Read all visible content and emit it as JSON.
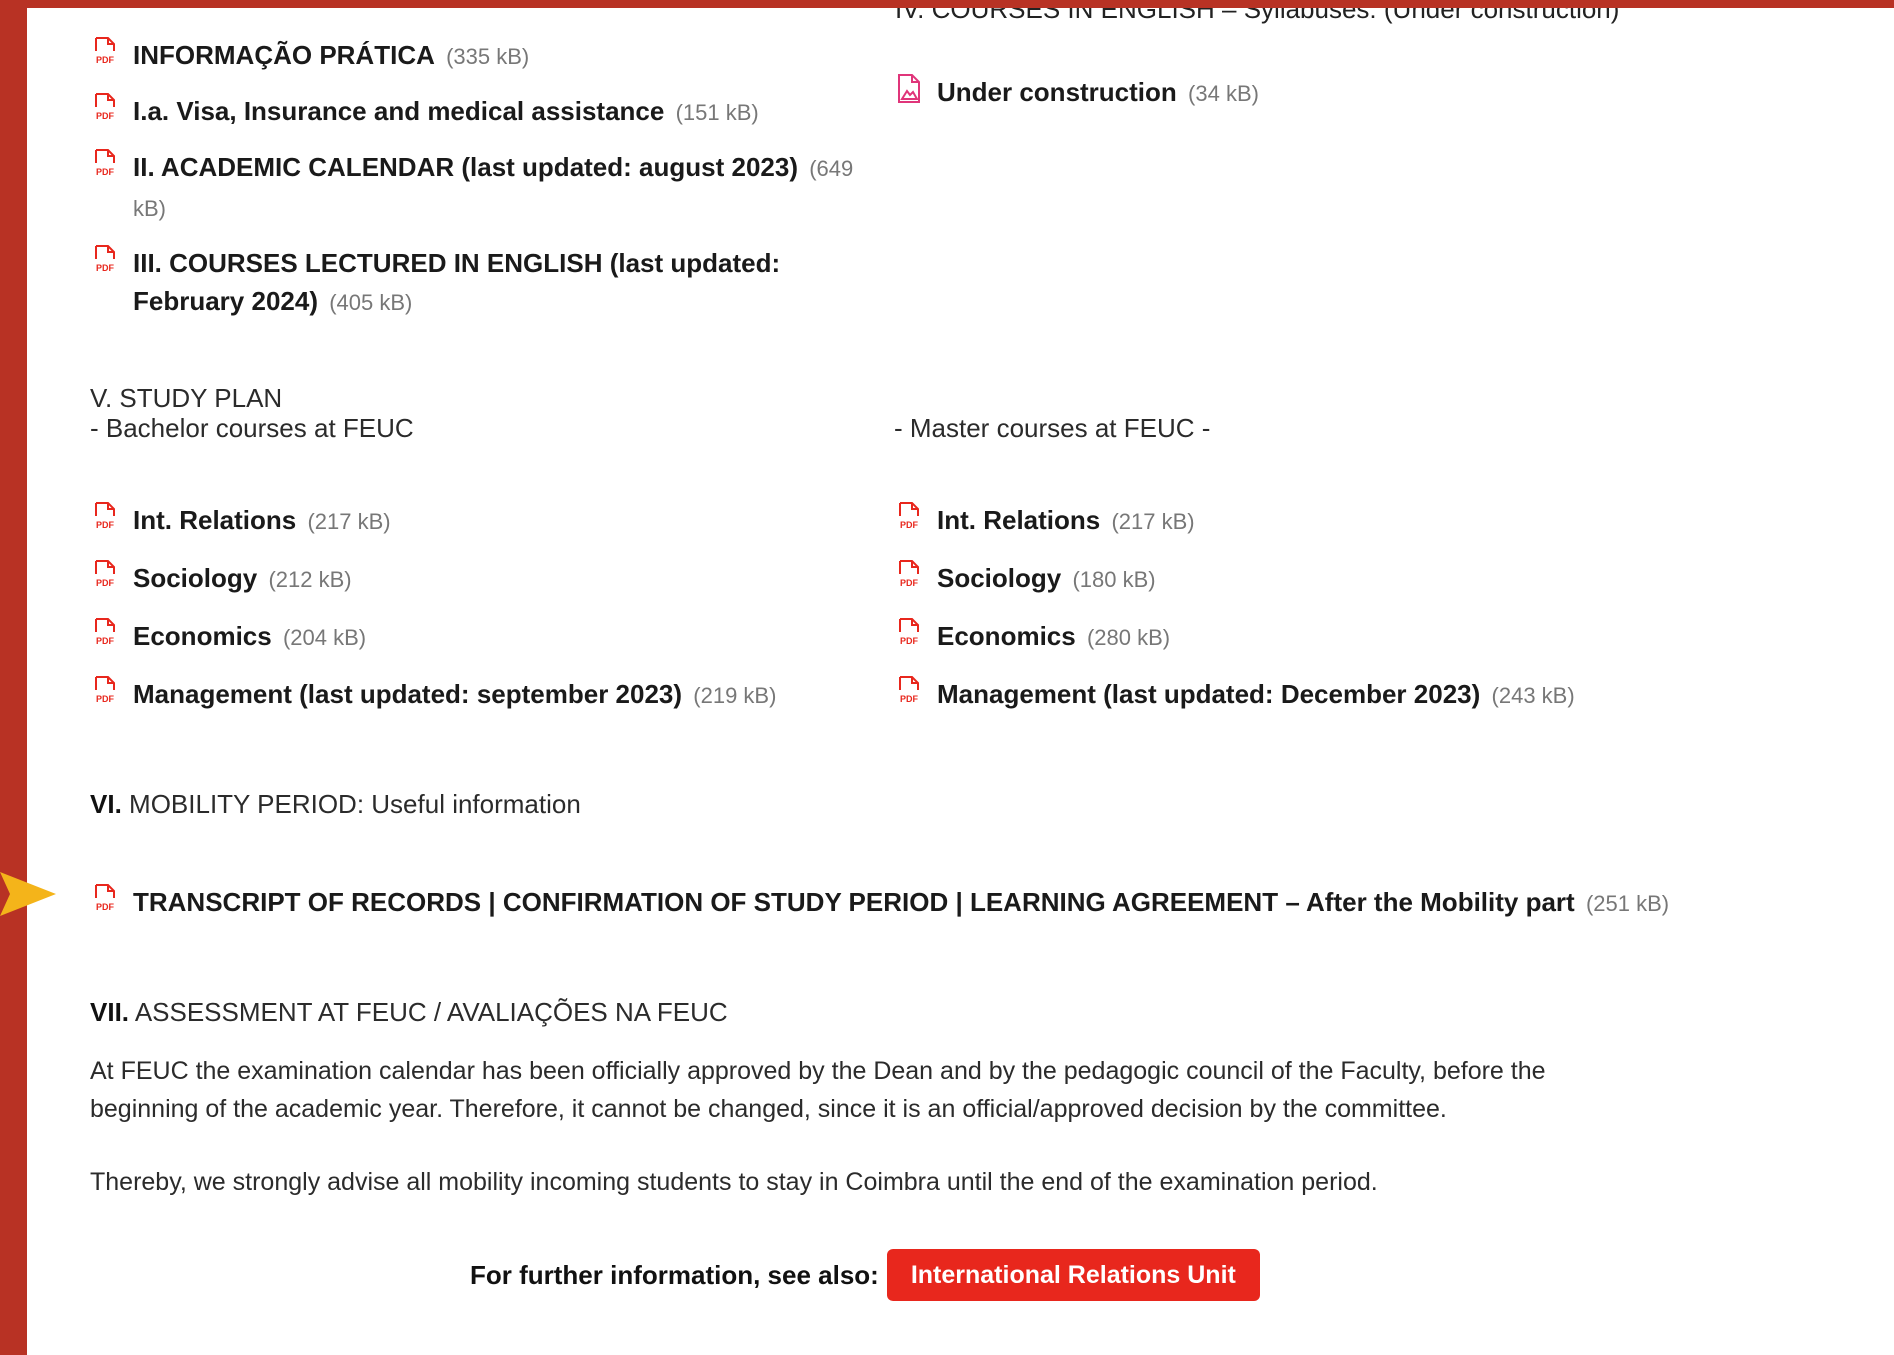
{
  "top_cut": {
    "left": ", ...",
    "right": "IV. COURSES IN ENGLISH – Syllabuses: (Under construction)"
  },
  "left_docs": [
    {
      "title": "INFORMAÇÃO PRÁTICA",
      "size": "(335 kB)"
    },
    {
      "title": "I.a. Visa, Insurance and medical assistance",
      "size": "(151 kB)"
    },
    {
      "title": "II. ACADEMIC CALENDAR (last updated: august 2023)",
      "size": "(649 kB)"
    },
    {
      "title": "III. COURSES LECTURED IN ENGLISH (last updated: February 2024)",
      "size": "(405 kB)"
    }
  ],
  "right_doc": {
    "title": "Under construction",
    "size": "(34 kB)"
  },
  "study_plan": {
    "heading": "V. STUDY PLAN",
    "bachelor_label": "- Bachelor courses at FEUC",
    "master_label": "- Master courses at FEUC -",
    "bachelor": [
      {
        "title": "Int. Relations",
        "size": "(217 kB)"
      },
      {
        "title": "Sociology",
        "size": "(212 kB)"
      },
      {
        "title": "Economics",
        "size": "(204 kB)"
      },
      {
        "title": "Management (last updated: september 2023)",
        "size": "(219 kB)"
      }
    ],
    "master": [
      {
        "title": "Int. Relations",
        "size": "(217 kB)"
      },
      {
        "title": "Sociology",
        "size": "(180 kB)"
      },
      {
        "title": "Economics",
        "size": "(280 kB)"
      },
      {
        "title": "Management (last updated: December 2023)",
        "size": "(243 kB)"
      }
    ]
  },
  "mobility": {
    "num": "VI.",
    "heading": "MOBILITY PERIOD: Useful information",
    "doc_title": "TRANSCRIPT OF RECORDS | CONFIRMATION OF STUDY PERIOD | LEARNING AGREEMENT – After the Mobility part",
    "doc_size": "(251 kB)"
  },
  "assessment": {
    "num": "VII.",
    "heading": "ASSESSMENT AT FEUC / AVALIAÇÕES NA FEUC",
    "para1": "At FEUC the examination calendar has been officially approved by the Dean and by the pedagogic council of the Faculty, before the beginning of the academic year. Therefore, it cannot be changed, since it is an official/approved decision by the committee.",
    "para2": "Thereby, we strongly advise all mobility incoming students to stay in Coimbra until the end of the examination period."
  },
  "further": {
    "label": "For further information, see also:",
    "button": "International Relations Unit"
  },
  "colors": {
    "frame": "#b83224",
    "pdf_icon": "#e8271d",
    "button": "#e8271d",
    "arrow": "#f4b41a"
  }
}
